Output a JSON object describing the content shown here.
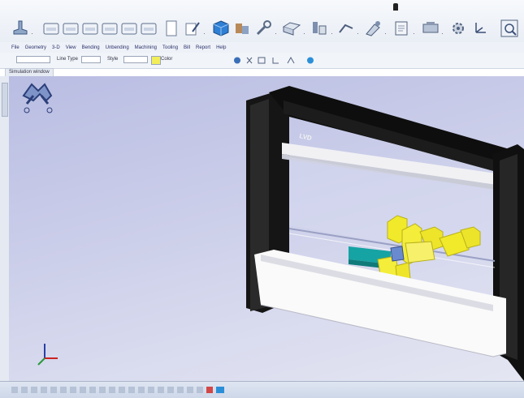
{
  "menu": {
    "items": [
      "File",
      "Geometry",
      "3-D",
      "View",
      "Bending",
      "Unbending",
      "Machining",
      "Tooling",
      "Bill",
      "Report",
      "Help"
    ]
  },
  "sub_toolbar": {
    "line_type_label": "Line Type",
    "color_label": "Color"
  },
  "document_tab": {
    "label": "Simulation window"
  },
  "machine": {
    "brand": "LVD"
  },
  "colors": {
    "machine_frame": "#111111",
    "tooling": "#f0ea2a",
    "part": "#1aa0a0",
    "viewport_top": "#b9bde2",
    "viewport_bottom": "#e4e6f2"
  },
  "icons": {
    "toolbar": [
      "bend-tool-icon",
      "sheet-icon",
      "sheet-icon",
      "sheet-icon",
      "sheet-icon",
      "sheet-icon",
      "sheet-icon",
      "page-icon",
      "pencil-icon",
      "box-3d-icon",
      "tools-icon",
      "wrench-icon",
      "flat-pattern-icon",
      "punch-icon",
      "bend-line-icon",
      "tool-select-icon",
      "report-icon",
      "machine-icon",
      "gear-icon",
      "xyz-axis-icon",
      "zoom-fit-icon"
    ]
  }
}
